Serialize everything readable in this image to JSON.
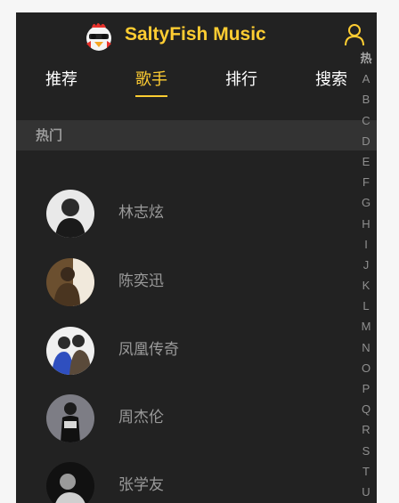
{
  "header": {
    "brand": "SaltyFish Music",
    "logo_icon": "chicken-mascot-icon",
    "user_icon": "user-profile-icon"
  },
  "tabs": [
    {
      "label": "推荐",
      "active": false
    },
    {
      "label": "歌手",
      "active": true
    },
    {
      "label": "排行",
      "active": false
    },
    {
      "label": "搜索",
      "active": false
    }
  ],
  "group": {
    "title": "热门"
  },
  "singers": [
    {
      "name": "林志炫"
    },
    {
      "name": "陈奕迅"
    },
    {
      "name": "凤凰传奇"
    },
    {
      "name": "周杰伦"
    },
    {
      "name": "张学友"
    }
  ],
  "shortcut_list": [
    "热",
    "A",
    "B",
    "C",
    "D",
    "E",
    "F",
    "G",
    "H",
    "I",
    "J",
    "K",
    "L",
    "M",
    "N",
    "O",
    "P",
    "Q",
    "R",
    "S",
    "T",
    "U"
  ],
  "colors": {
    "accent": "#ffcd32",
    "background": "#222222",
    "group_header": "#333333",
    "muted_text": "#9a9a9a"
  }
}
